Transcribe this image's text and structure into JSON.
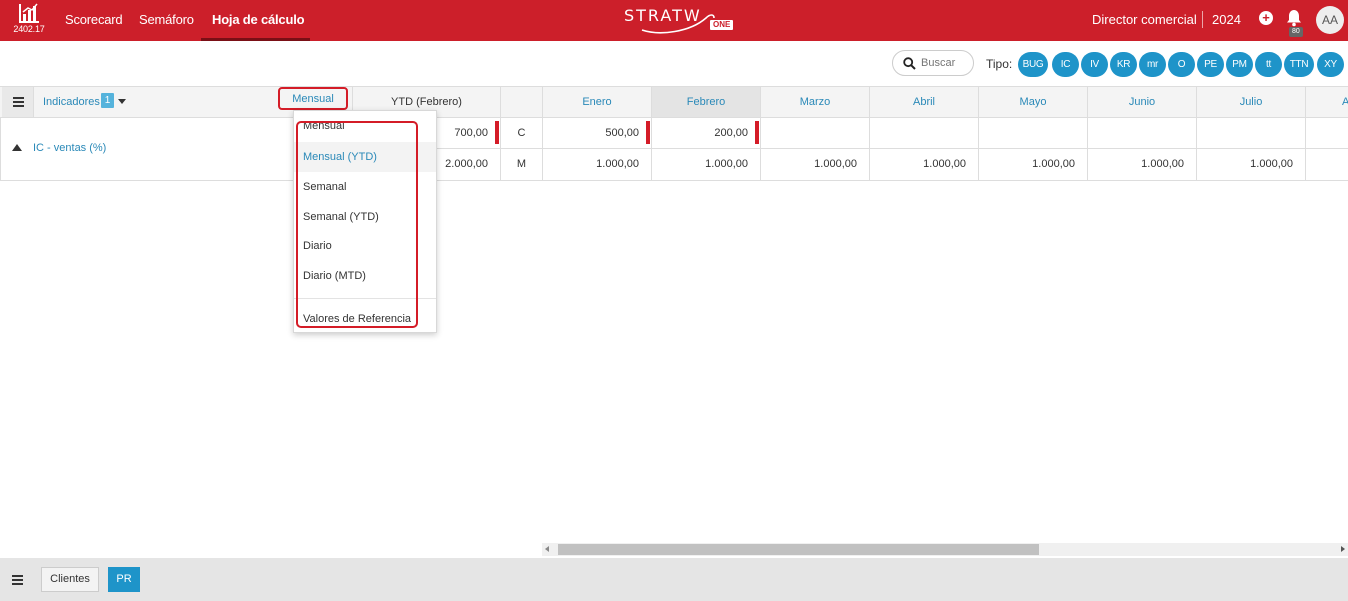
{
  "header": {
    "version": "2402.17",
    "nav": [
      "Scorecard",
      "Semáforo",
      "Hoja de cálculo"
    ],
    "active_nav": "Hoja de cálculo",
    "brand": "STRATW",
    "brand_suffix": "ONE",
    "role": "Director comercial",
    "year": "2024",
    "notifications": "80",
    "avatar": "AA",
    "accent_color": "#cc1f2a"
  },
  "filters": {
    "search_placeholder": "Buscar",
    "tipo_label": "Tipo:",
    "types": [
      "BUG",
      "IC",
      "IV",
      "KR",
      "mr",
      "O",
      "PE",
      "PM",
      "tt",
      "TTN",
      "XY"
    ],
    "type_color": "#1e94c9"
  },
  "grid": {
    "indicators_label": "Indicadores",
    "indicators_count": "1",
    "period_selected": "Mensual",
    "ytd_label": "YTD (Febrero)",
    "months": [
      "Enero",
      "Febrero",
      "Marzo",
      "Abril",
      "Mayo",
      "Junio",
      "Julio",
      "A"
    ],
    "indicator_name": "IC - ventas (%)",
    "rows": [
      {
        "ytd": "700,00",
        "code": "C",
        "values": [
          "500,00",
          "200,00",
          "",
          "",
          "",
          "",
          ""
        ]
      },
      {
        "ytd": "2.000,00",
        "code": "M",
        "values": [
          "1.000,00",
          "1.000,00",
          "1.000,00",
          "1.000,00",
          "1.000,00",
          "1.000,00",
          "1.000,00"
        ]
      }
    ]
  },
  "dropdown": {
    "items": [
      "Mensual",
      "Mensual (YTD)",
      "Semanal",
      "Semanal (YTD)",
      "Diario",
      "Diario (MTD)"
    ],
    "highlighted": "Mensual (YTD)",
    "footer_item": "Valores de Referencia"
  },
  "footer": {
    "tabs": [
      "Clientes",
      "PR"
    ],
    "active_tab": "PR"
  }
}
